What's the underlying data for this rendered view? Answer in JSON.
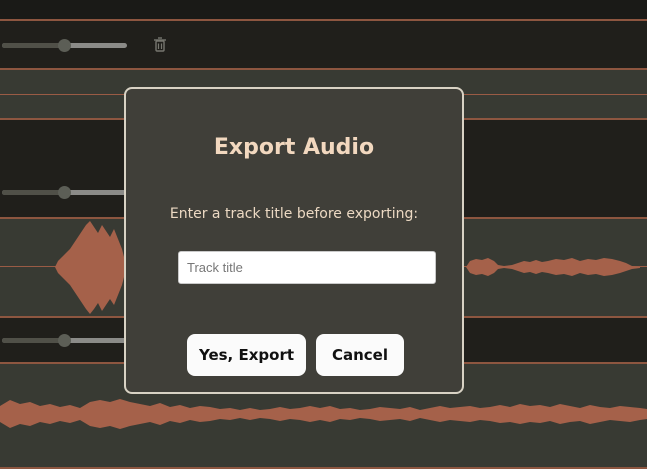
{
  "dialog": {
    "title": "Export Audio",
    "message": "Enter a track title before exporting:",
    "input_placeholder": "Track title",
    "input_value": "",
    "confirm_label": "Yes, Export",
    "cancel_label": "Cancel"
  },
  "tracks": [
    {
      "volume": 0.5,
      "icons": [
        "trash-icon"
      ]
    },
    {
      "volume": 0.5
    },
    {
      "volume": 0.5
    }
  ],
  "colors": {
    "background": "#1f1e1a",
    "lane": "#383a33",
    "waveform": "#a5614a",
    "track_divider": "#8d5640",
    "dialog_bg": "#403f39",
    "dialog_title": "#f2d8bf",
    "dialog_border": "#d8d2c4",
    "button_bg": "#fbfbfb"
  }
}
